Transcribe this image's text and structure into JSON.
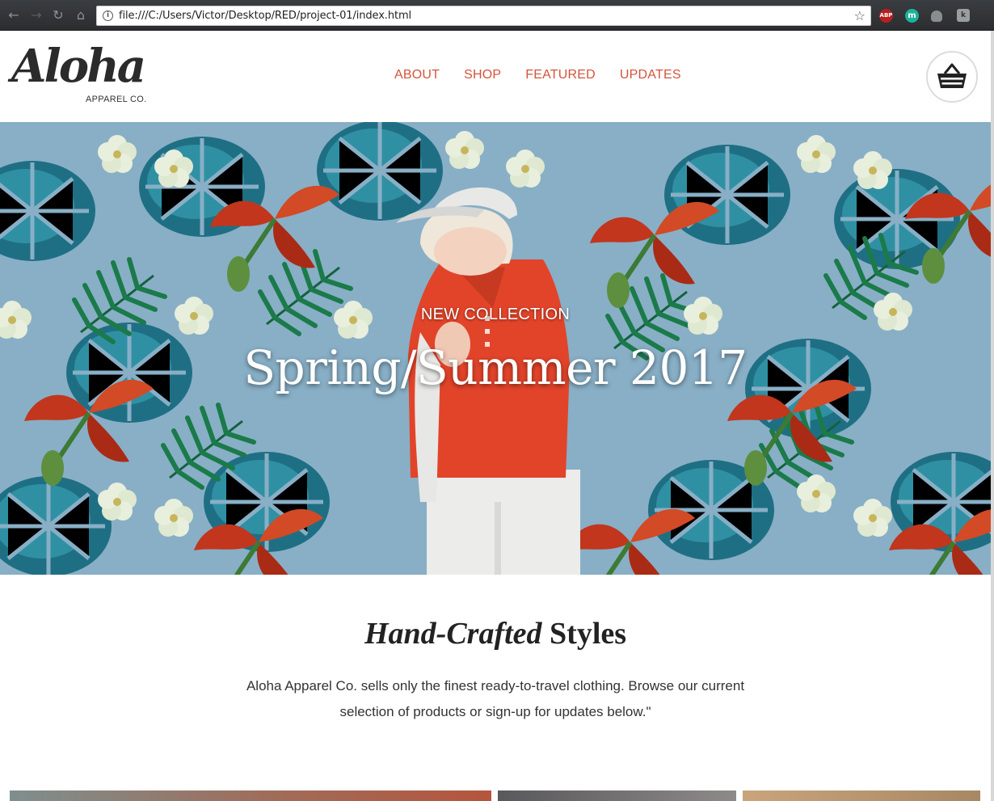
{
  "browser": {
    "url": "file:///C:/Users/Victor/Desktop/RED/project-01/index.html",
    "extensions": [
      {
        "name": "adblock-plus",
        "label": "ABP",
        "color": "#b81f1f"
      },
      {
        "name": "m-extension",
        "label": "m",
        "color": "#1bb39c"
      },
      {
        "name": "mic-extension",
        "label": "",
        "color": "#8a8d90"
      },
      {
        "name": "k-extension",
        "label": "k",
        "color": "#9b9ea1"
      }
    ]
  },
  "header": {
    "logo_script": "Aloha",
    "logo_sub": "APPAREL CO.",
    "nav": [
      "ABOUT",
      "SHOP",
      "FEATURED",
      "UPDATES"
    ],
    "nav_color": "#d4533a",
    "cart_icon": "basket-icon"
  },
  "hero": {
    "kicker": "NEW COLLECTION",
    "title": "Spring/Summer 2017",
    "background_color": "#88afc6"
  },
  "intro": {
    "heading_italic": "Hand-Crafted",
    "heading_bold": "Styles",
    "copy": "Aloha Apparel Co. sells only the finest ready-to-travel clothing. Browse our current selection of products or sign-up for updates below.\""
  }
}
